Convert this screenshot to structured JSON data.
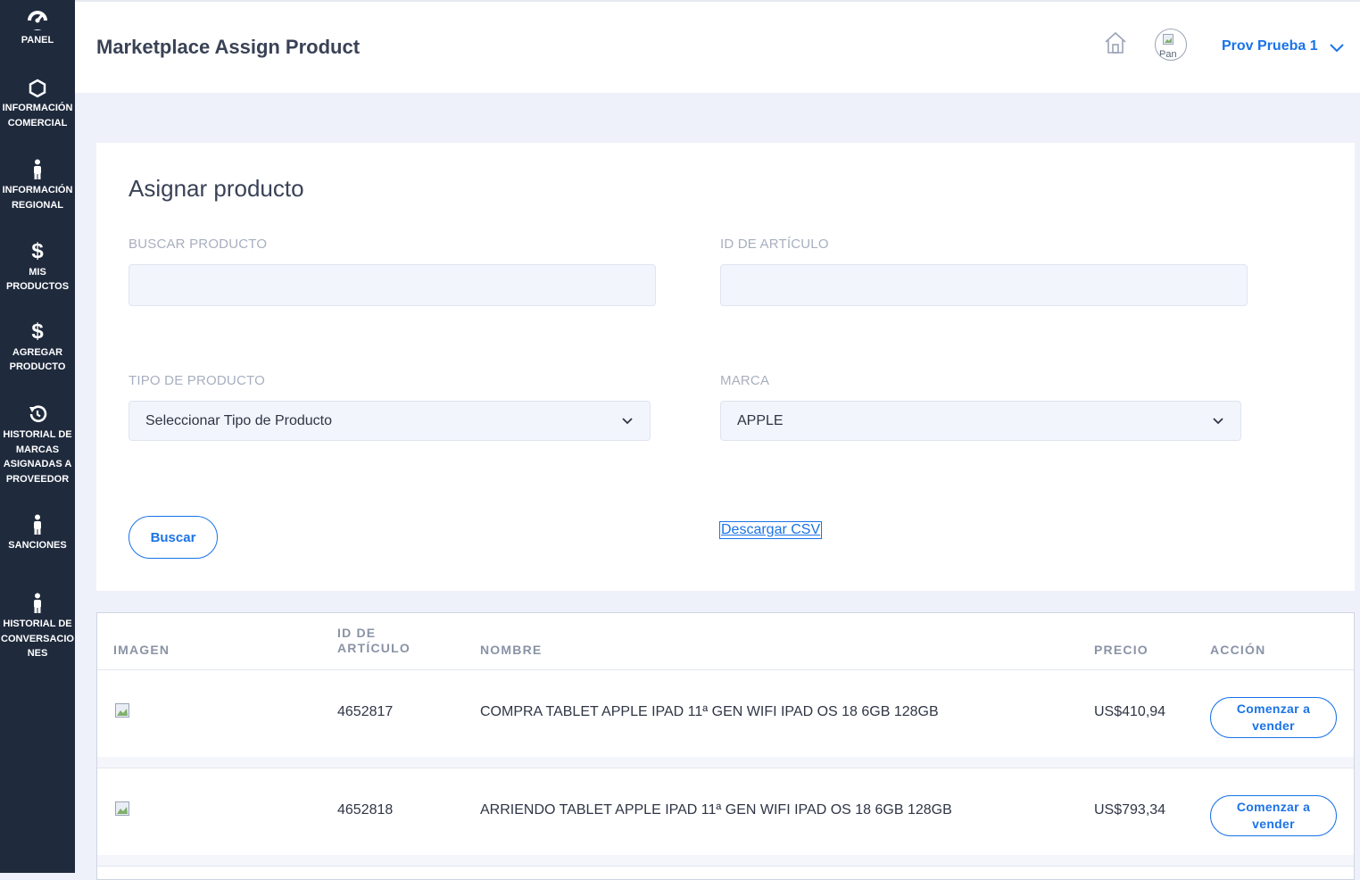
{
  "sidebar": {
    "items": [
      {
        "label": "PANEL",
        "icon": "speedometer-icon"
      },
      {
        "label": "INFORMACIÓN COMERCIAL",
        "icon": "hexagon-icon"
      },
      {
        "label": "INFORMACIÓN REGIONAL",
        "icon": "person-icon"
      },
      {
        "label": "MIS PRODUCTOS",
        "icon": "dollar-icon"
      },
      {
        "label": "AGREGAR PRODUCTO",
        "icon": "dollar-icon"
      },
      {
        "label": "HISTORIAL DE MARCAS ASIGNADAS A PROVEEDOR",
        "icon": "history-icon"
      },
      {
        "label": "SANCIONES",
        "icon": "person-icon"
      },
      {
        "label": "HISTORIAL DE CONVERSACIONES",
        "icon": "person-icon"
      }
    ]
  },
  "header": {
    "title": "Marketplace Assign Product",
    "avatar_alt": "Pan",
    "user_name": "Prov Prueba 1"
  },
  "form": {
    "title": "Asignar producto",
    "search_label": "BUSCAR PRODUCTO",
    "search_value": "",
    "item_id_label": "ID DE ARTÍCULO",
    "item_id_value": "",
    "product_type_label": "TIPO DE PRODUCTO",
    "product_type_value": "Seleccionar Tipo de Producto",
    "brand_label": "MARCA",
    "brand_value": "APPLE",
    "search_button": "Buscar",
    "csv_link": "Descargar CSV"
  },
  "table": {
    "columns": {
      "image": "IMAGEN",
      "item_id_line1": "ID DE",
      "item_id_line2": "ARTÍCULO",
      "name": "NOMBRE",
      "price": "PRECIO",
      "action": "ACCIÓN"
    },
    "rows": [
      {
        "id": "4652817",
        "name": "COMPRA TABLET APPLE IPAD 11ª GEN WIFI IPAD OS 18 6GB 128GB",
        "price": "US$410,94",
        "action": "Comenzar a vender"
      },
      {
        "id": "4652818",
        "name": "ARRIENDO TABLET APPLE IPAD 11ª GEN WIFI IPAD OS 18 6GB 128GB",
        "price": "US$793,34",
        "action": "Comenzar a vender"
      }
    ]
  },
  "colors": {
    "sidebar_bg": "#1f2a3d",
    "accent": "#1a73e8",
    "page_bg": "#eef1fa"
  }
}
